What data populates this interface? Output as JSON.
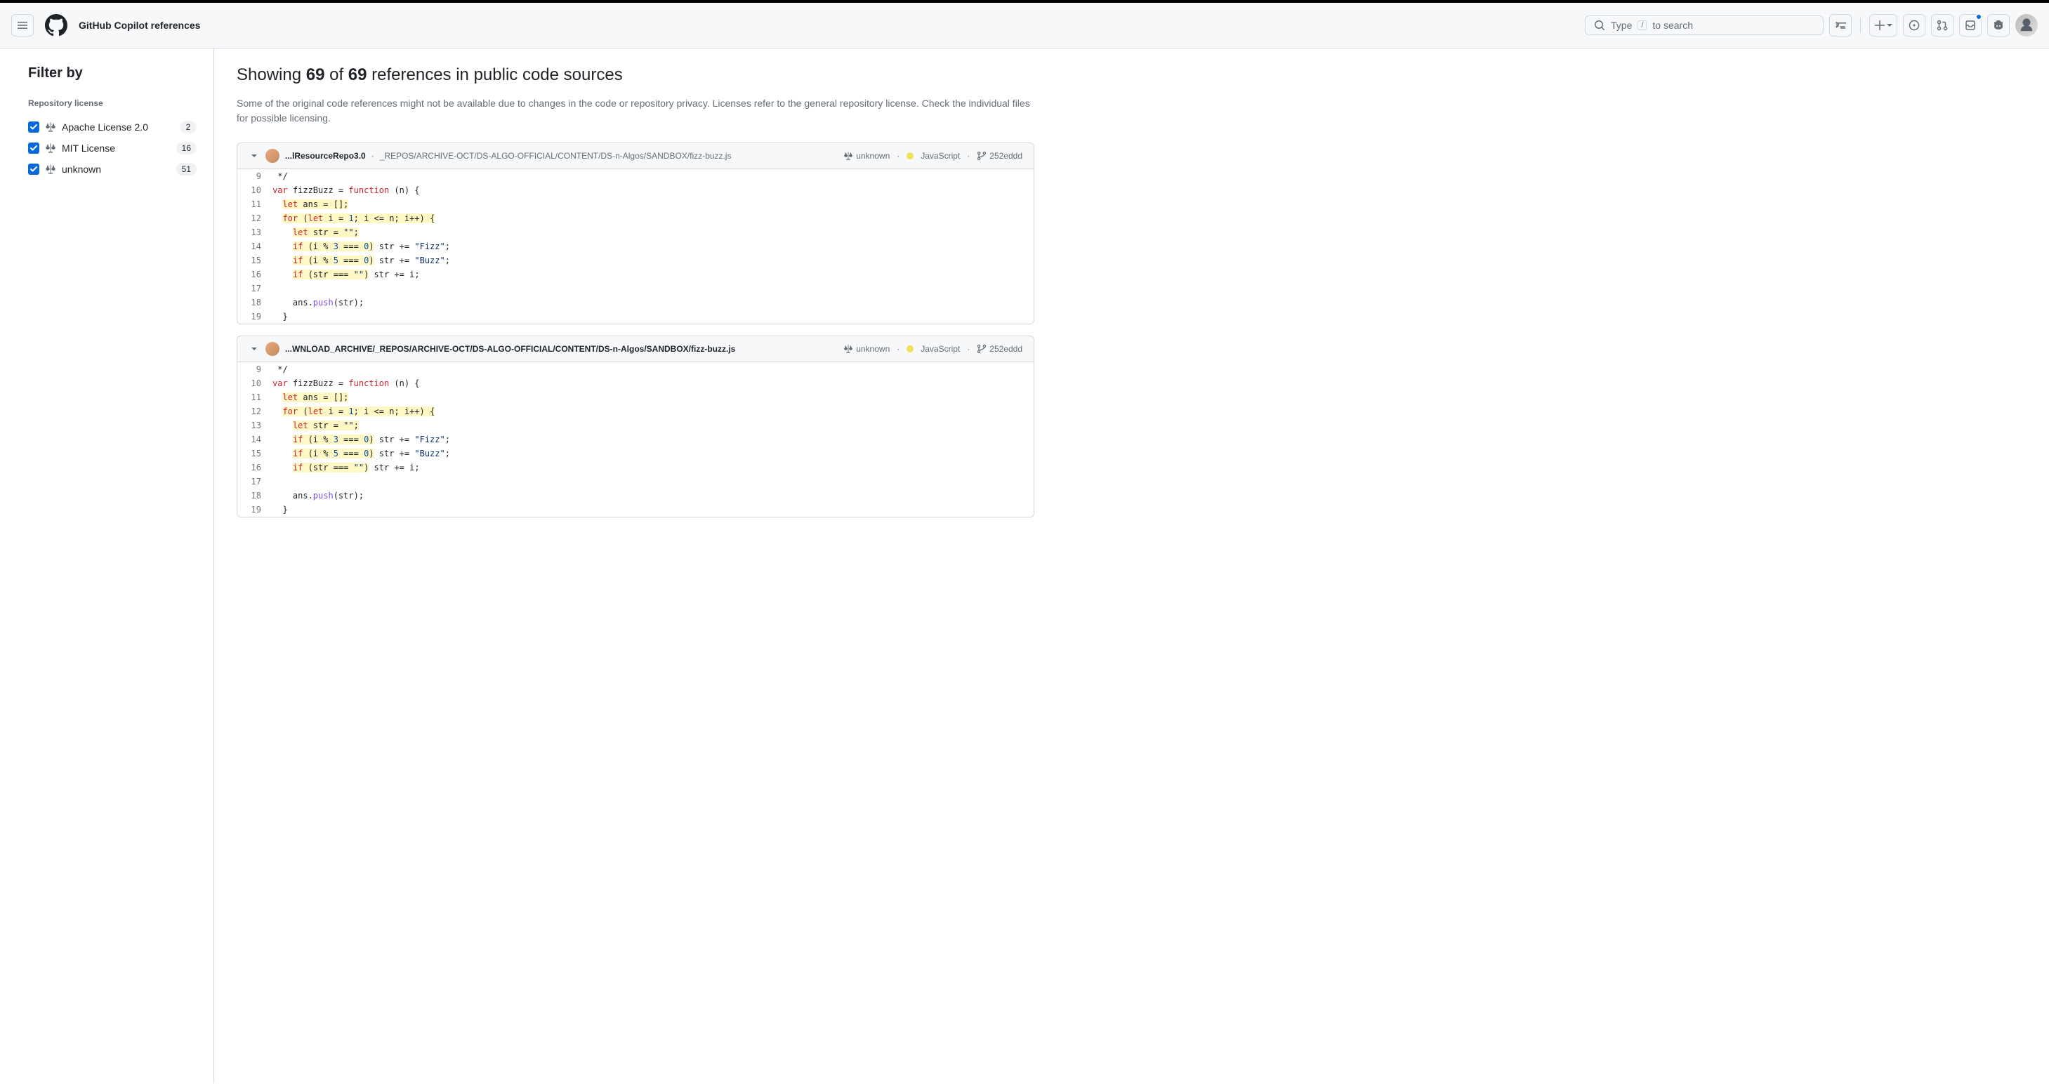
{
  "header": {
    "page_title": "GitHub Copilot references",
    "search_placeholder_before": "Type ",
    "search_placeholder_kbd": "/",
    "search_placeholder_after": " to search"
  },
  "sidebar": {
    "title": "Filter by",
    "group_title": "Repository license",
    "items": [
      {
        "label": "Apache License 2.0",
        "count": "2",
        "checked": true
      },
      {
        "label": "MIT License",
        "count": "16",
        "checked": true
      },
      {
        "label": "unknown",
        "count": "51",
        "checked": true
      }
    ]
  },
  "main": {
    "heading_pre": "Showing ",
    "count_shown": "69",
    "heading_mid": " of ",
    "count_total": "69",
    "heading_post": " references in public code sources",
    "description": "Some of the original code references might not be available due to changes in the code or repository privacy. Licenses refer to the general repository license. Check the individual files for possible licensing."
  },
  "results": [
    {
      "repo": "...lResourceRepo3.0",
      "path_sep": " · ",
      "path": "_REPOS/ARCHIVE-OCT/DS-ALGO-OFFICIAL/CONTENT/DS-n-Algos/SANDBOX/fizz-buzz.js",
      "license": "unknown",
      "language": "JavaScript",
      "branch": "252eddd"
    },
    {
      "repo": "...WNLOAD_ARCHIVE/_REPOS/ARCHIVE-OCT/DS-ALGO-OFFICIAL/CONTENT/DS-n-Algos/SANDBOX/fizz-buzz.js",
      "path_sep": "",
      "path": "",
      "license": "unknown",
      "language": "JavaScript",
      "branch": "252eddd"
    }
  ],
  "code": {
    "linenos": [
      "9",
      "10",
      "11",
      "12",
      "13",
      "14",
      "15",
      "16",
      "17",
      "18",
      "19"
    ]
  }
}
